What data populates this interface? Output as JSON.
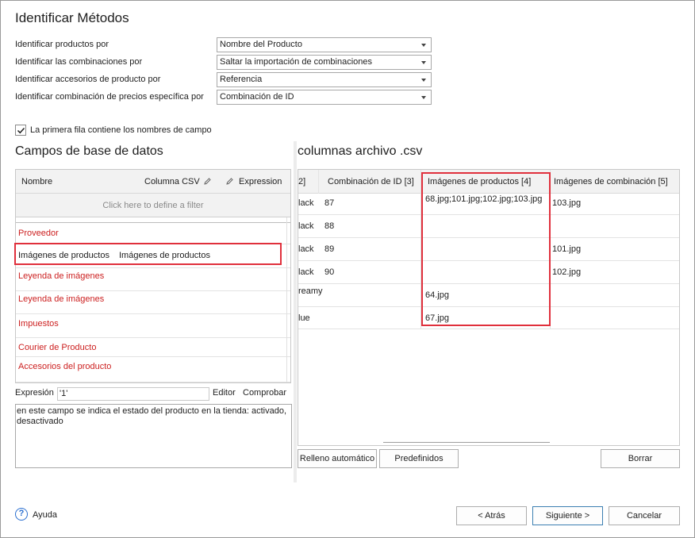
{
  "title": "Identificar Métodos",
  "fields": [
    {
      "label": "Identificar productos por",
      "value": "Nombre del Producto"
    },
    {
      "label": "Identificar las combinaciones por",
      "value": "Saltar la importación de combinaciones"
    },
    {
      "label": "Identificar accesorios de producto por",
      "value": "Referencia"
    },
    {
      "label": "Identificar combinación de precios específica por",
      "value": "Combinación de ID"
    }
  ],
  "first_row_checkbox": {
    "label": "La primera fila contiene los nombres de campo",
    "checked": true
  },
  "left_panel": {
    "title": "Campos de base de datos",
    "columns": {
      "nombre": "Nombre",
      "columna_csv": "Columna CSV",
      "expression": "Expression"
    },
    "filter_text": "Click here to define a filter",
    "rows": [
      {
        "name": "Proveedor",
        "csv": "",
        "required": true
      },
      {
        "name": "Imágenes de productos",
        "csv": "Imágenes de productos",
        "required": false
      },
      {
        "name": "Leyenda de imágenes",
        "csv": "",
        "required": true
      },
      {
        "name": "Leyenda de imágenes",
        "csv": "",
        "required": true
      },
      {
        "name": "Impuestos",
        "csv": "",
        "required": true
      },
      {
        "name": "Courier de Producto",
        "csv": "",
        "required": true
      },
      {
        "name": "Accesorios del producto",
        "csv": "",
        "required": true
      }
    ]
  },
  "expression": {
    "label": "Expresión",
    "value": "'1'",
    "editor_label": "Editor",
    "check_label": "Comprobar",
    "description": "en este campo se indica el estado del producto en la tienda: activado, desactivado"
  },
  "right_panel": {
    "title": "columnas archivo .csv",
    "columns": [
      "2]",
      "Combinación de ID [3]",
      "Imágenes de productos [4]",
      "Imágenes de combinación [5]"
    ],
    "rows": [
      [
        "lack",
        "87",
        "68.jpg;101.jpg;102.jpg;103.jpg",
        "103.jpg"
      ],
      [
        "lack",
        "88",
        "",
        ""
      ],
      [
        "lack",
        "89",
        "",
        "101.jpg"
      ],
      [
        "lack",
        "90",
        "",
        "102.jpg"
      ],
      [
        "reamy",
        "",
        "64.jpg",
        ""
      ],
      [
        "lue",
        "",
        "67.jpg",
        ""
      ]
    ]
  },
  "buttons": {
    "autofill": "Relleno automático",
    "predefined": "Predefinidos",
    "delete": "Borrar",
    "back": "< Atrás",
    "next": "Siguiente >",
    "cancel": "Cancelar",
    "help": "Ayuda"
  },
  "colors": {
    "required_field": "#cc1f1f",
    "highlight": "#e0303c",
    "help_icon": "#2a6fd0"
  }
}
